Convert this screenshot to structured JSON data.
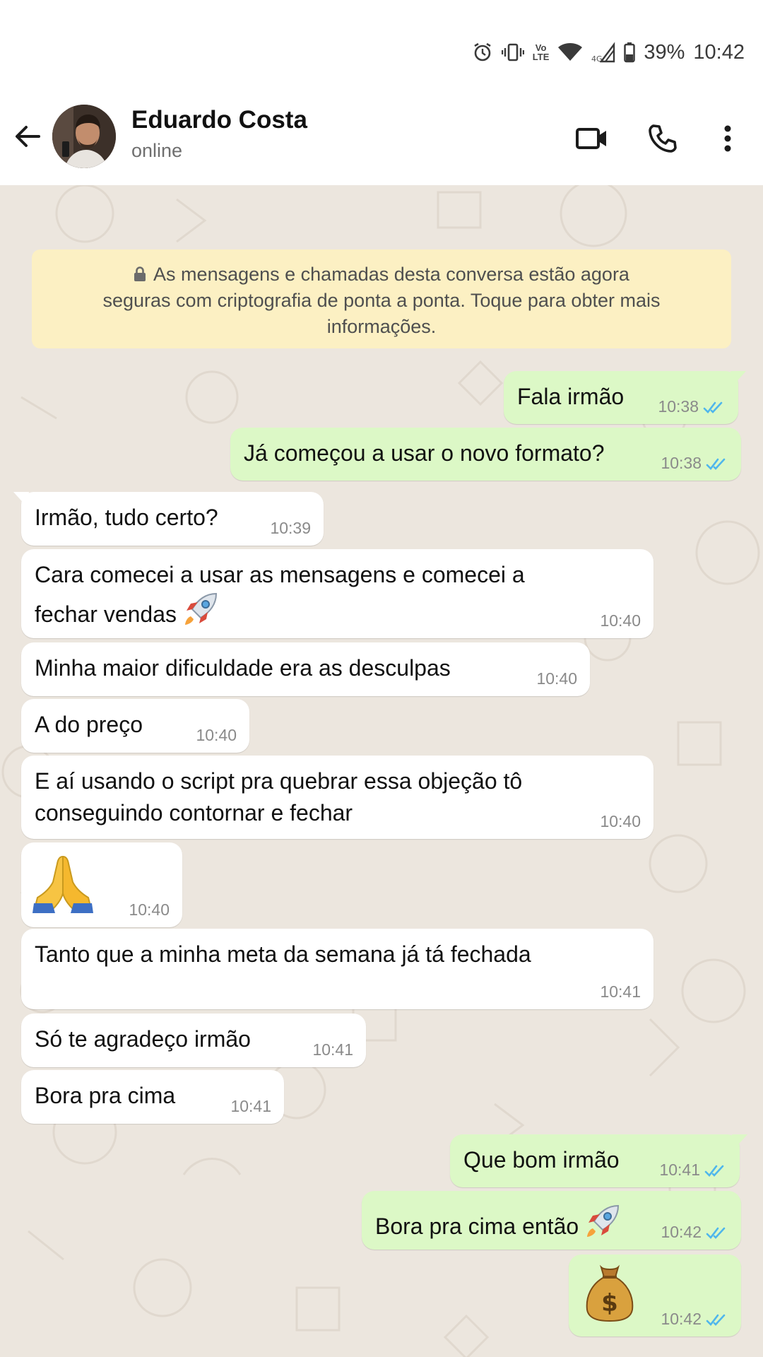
{
  "status_bar": {
    "battery": "39%",
    "time": "10:42",
    "icons": [
      "alarm-icon",
      "vibrate-icon",
      "volte-icon",
      "wifi-icon",
      "signal-4g-icon",
      "battery-icon"
    ],
    "volte_top": "Vo",
    "volte_bottom": "LTE"
  },
  "header": {
    "name": "Eduardo Costa",
    "status": "online",
    "icons": [
      "back-arrow-icon",
      "video-call-icon",
      "voice-call-icon",
      "more-options-icon"
    ]
  },
  "notice": {
    "text": "As mensagens e chamadas desta conversa estão agora seguras com criptografia de ponta a ponta. Toque para obter mais informações.",
    "line1": "As mensagens e chamadas desta conversa estão agora",
    "line2": "seguras com criptografia de ponta a ponta. Toque para obter mais",
    "line3": "informações."
  },
  "messages": [
    {
      "dir": "out",
      "text": "Fala irmão",
      "time": "10:38",
      "read": true
    },
    {
      "dir": "out",
      "text": "Já começou a usar o novo formato?",
      "time": "10:38",
      "read": true
    },
    {
      "dir": "in",
      "text": "Irmão, tudo certo?",
      "time": "10:39"
    },
    {
      "dir": "in",
      "line1": "Cara comecei a usar as mensagens e comecei a",
      "line2": "fechar vendas",
      "emoji": "rocket",
      "time": "10:40"
    },
    {
      "dir": "in",
      "text": "Minha maior dificuldade era as desculpas",
      "time": "10:40"
    },
    {
      "dir": "in",
      "text": "A do preço",
      "time": "10:40"
    },
    {
      "dir": "in",
      "line1": "E aí usando o script pra quebrar essa objeção tô",
      "line2": "conseguindo contornar e fechar",
      "time": "10:40"
    },
    {
      "dir": "in",
      "emoji": "folded-hands",
      "time": "10:40"
    },
    {
      "dir": "in",
      "text": "Tanto que a minha meta da semana já tá fechada",
      "time": "10:41"
    },
    {
      "dir": "in",
      "text": "Só te agradeço irmão",
      "time": "10:41"
    },
    {
      "dir": "in",
      "text": "Bora pra cima",
      "time": "10:41"
    },
    {
      "dir": "out",
      "text": "Que bom irmão",
      "time": "10:41",
      "read": true
    },
    {
      "dir": "out",
      "text": "Bora pra cima então",
      "emoji": "rocket",
      "time": "10:42",
      "read": true
    },
    {
      "dir": "out",
      "emoji": "money-bag",
      "time": "10:42",
      "read": true
    }
  ],
  "colors": {
    "chat_background": "#ece6de",
    "outgoing_bubble": "#dcf8c6",
    "incoming_bubble": "#ffffff",
    "notice_background": "#fcf0c3",
    "read_ticks": "#4fb6ec"
  }
}
